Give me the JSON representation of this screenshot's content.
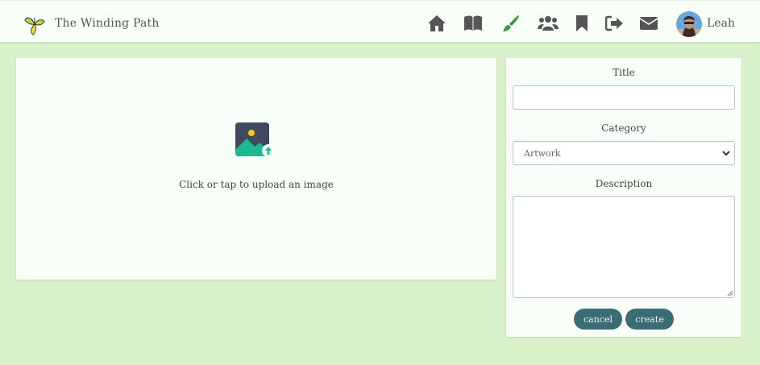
{
  "app": {
    "name": "The Winding Path"
  },
  "nav": {
    "icons": [
      "home-icon",
      "book-icon",
      "brush-icon",
      "users-icon",
      "bookmark-icon",
      "sign-out-icon",
      "envelope-icon"
    ],
    "active": "brush-icon",
    "active_color": "#3a9a3a",
    "icon_color": "#555555",
    "username": "Leah"
  },
  "upload": {
    "prompt": "Click or tap to upload an image"
  },
  "form": {
    "title_label": "Title",
    "title_value": "",
    "category_label": "Category",
    "category_value": "Artwork",
    "description_label": "Description",
    "description_value": "",
    "cancel_label": "cancel",
    "create_label": "create"
  },
  "colors": {
    "background": "#d9f2c9",
    "panel": "#f7fff8",
    "button": "#3b6b73",
    "accent_teal": "#1db990"
  }
}
